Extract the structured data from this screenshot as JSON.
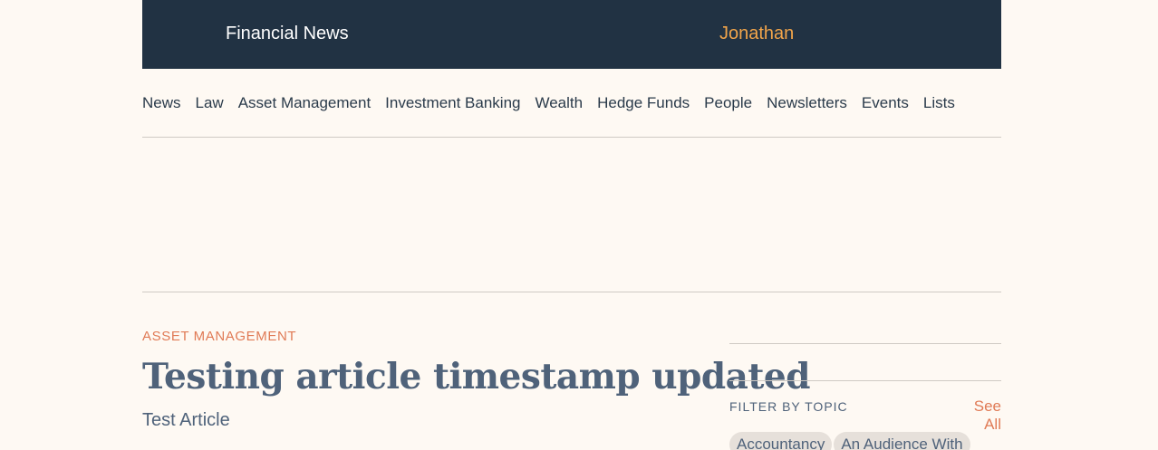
{
  "header": {
    "brand": "Financial News",
    "user_name": "Jonathan",
    "colors": {
      "background": "#213243",
      "brand_text": "#ffffff",
      "user_text": "#f2a54a"
    }
  },
  "nav": {
    "items": [
      "News",
      "Law",
      "Asset Management",
      "Investment Banking",
      "Wealth",
      "Hedge Funds",
      "People",
      "Newsletters",
      "Events",
      "Lists"
    ]
  },
  "article": {
    "section": "ASSET MANAGEMENT",
    "headline": "Testing article timestamp updated",
    "standfirst": "Test Article",
    "colors": {
      "section": "#e07a55",
      "headline": "#4f627a"
    }
  },
  "sidebar": {
    "filter_label": "FILTER BY TOPIC",
    "see_all": "See All",
    "topics": [
      "Accountancy",
      "An Audience With"
    ]
  },
  "page": {
    "background": "#fef9f3"
  }
}
